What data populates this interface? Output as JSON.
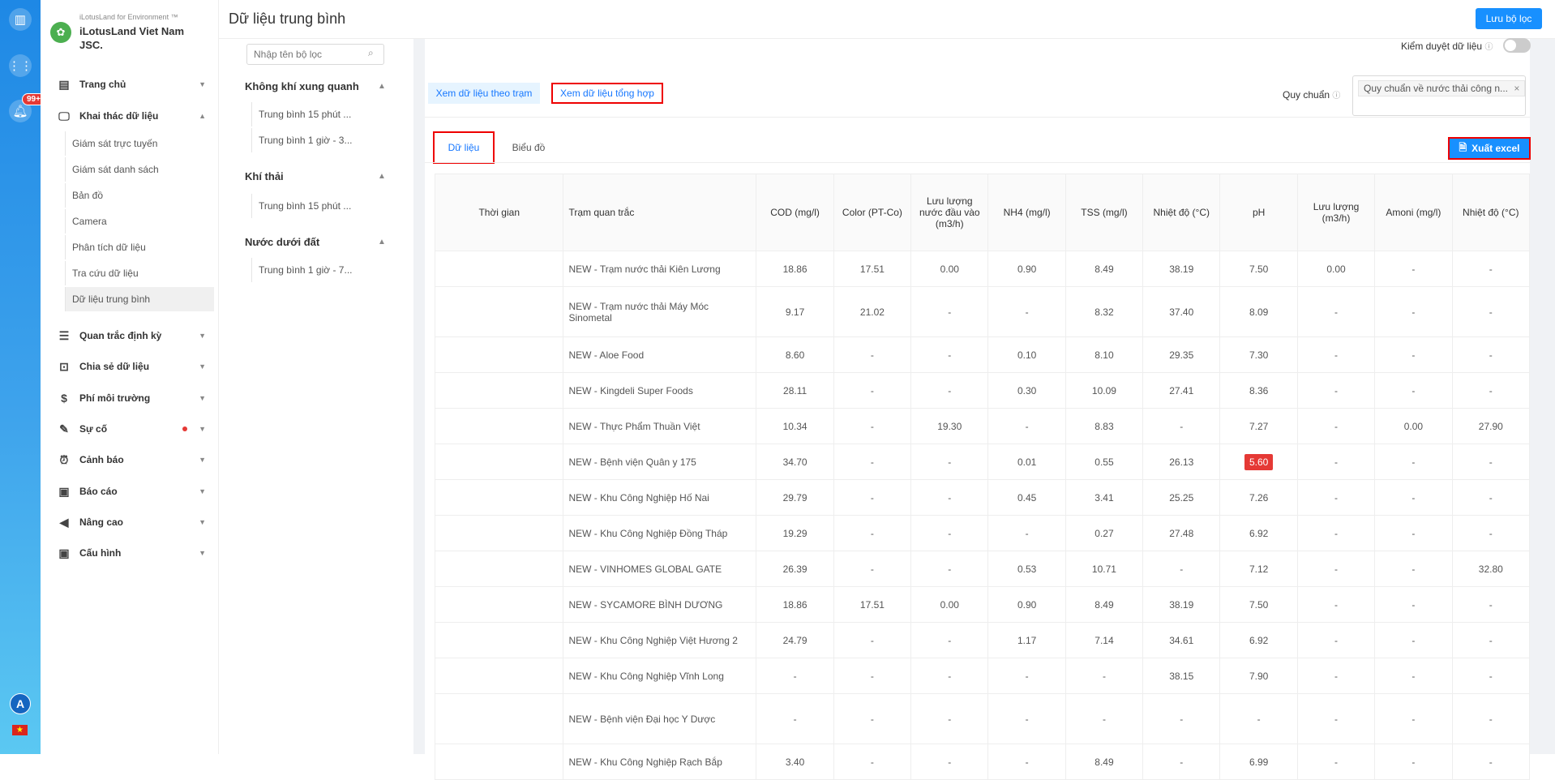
{
  "rail": {
    "badge": "99+",
    "avatar": "A",
    "flag": "★"
  },
  "brand": {
    "sub": "iLotusLand for Environment ™",
    "name": "iLotusLand Viet Nam JSC."
  },
  "nav": {
    "home": "Trang chủ",
    "data_exploit": "Khai thác dữ liệu",
    "sub_items": [
      "Giám sát trực tuyến",
      "Giám sát danh sách",
      "Bản đồ",
      "Camera",
      "Phân tích dữ liệu",
      "Tra cứu dữ liệu",
      "Dữ liệu trung bình"
    ],
    "periodic": "Quan trắc định kỳ",
    "share": "Chia sẻ dữ liệu",
    "fee": "Phí môi trường",
    "incident": "Sự cố",
    "alert": "Cảnh báo",
    "report": "Báo cáo",
    "advanced": "Nâng cao",
    "config": "Cấu hình"
  },
  "header": {
    "title": "Dữ liệu trung bình",
    "save_filter": "Lưu bộ lọc"
  },
  "filters": {
    "search_placeholder": "Nhập tên bộ lọc",
    "groups": [
      {
        "title": "Không khí xung quanh",
        "items": [
          "Trung bình 15 phút ...",
          "Trung bình 1 giờ - 3..."
        ]
      },
      {
        "title": "Khí thải",
        "items": [
          "Trung bình 15 phút ..."
        ]
      },
      {
        "title": "Nước dưới đất",
        "items": [
          "Trung bình 1 giờ - 7..."
        ]
      }
    ]
  },
  "toolbar": {
    "approve_label": "Kiểm duyệt dữ liệu",
    "view_station": "Xem dữ liệu theo trạm",
    "view_aggregate": "Xem dữ liệu tổng hợp",
    "standard_label": "Quy chuẩn",
    "standard_value": "Quy chuẩn về nước thải công n...",
    "tab_data": "Dữ liệu",
    "tab_chart": "Biểu đồ",
    "export": "Xuất excel"
  },
  "table": {
    "headers": [
      "Thời gian",
      "Trạm quan trắc",
      "COD (mg/l)",
      "Color (PT-Co)",
      "Lưu lượng nước đầu vào (m3/h)",
      "NH4 (mg/l)",
      "TSS (mg/l)",
      "Nhiệt độ (°C)",
      "pH",
      "Lưu lượng (m3/h)",
      "Amoni (mg/l)",
      "Nhiệt độ (°C)"
    ],
    "rows": [
      [
        "",
        "NEW - Trạm nước thải Kiên Lương",
        "18.86",
        "17.51",
        "0.00",
        "0.90",
        "8.49",
        "38.19",
        "7.50",
        "0.00",
        "-",
        "-"
      ],
      [
        "",
        "NEW - Trạm nước thải Máy Móc Sinometal",
        "9.17",
        "21.02",
        "-",
        "-",
        "8.32",
        "37.40",
        "8.09",
        "-",
        "-",
        "-"
      ],
      [
        "",
        "NEW - Aloe Food",
        "8.60",
        "-",
        "-",
        "0.10",
        "8.10",
        "29.35",
        "7.30",
        "-",
        "-",
        "-"
      ],
      [
        "",
        "NEW - Kingdeli Super Foods",
        "28.11",
        "-",
        "-",
        "0.30",
        "10.09",
        "27.41",
        "8.36",
        "-",
        "-",
        "-"
      ],
      [
        "",
        "NEW - Thực Phẩm Thuần Việt",
        "10.34",
        "-",
        "19.30",
        "-",
        "8.83",
        "-",
        "7.27",
        "-",
        "0.00",
        "27.90"
      ],
      [
        "",
        "NEW - Bệnh viện Quân y 175",
        "34.70",
        "-",
        "-",
        "0.01",
        "0.55",
        "26.13",
        "5.60",
        "-",
        "-",
        "-"
      ],
      [
        "",
        "NEW -  Khu Công Nghiệp Hố Nai",
        "29.79",
        "-",
        "-",
        "0.45",
        "3.41",
        "25.25",
        "7.26",
        "-",
        "-",
        "-"
      ],
      [
        "",
        "NEW - Khu Công Nghiệp Đồng Tháp",
        "19.29",
        "-",
        "-",
        "-",
        "0.27",
        "27.48",
        "6.92",
        "-",
        "-",
        "-"
      ],
      [
        "",
        "NEW - VINHOMES GLOBAL GATE",
        "26.39",
        "-",
        "-",
        "0.53",
        "10.71",
        "-",
        "7.12",
        "-",
        "-",
        "32.80"
      ],
      [
        "",
        "NEW - SYCAMORE BÌNH DƯƠNG",
        "18.86",
        "17.51",
        "0.00",
        "0.90",
        "8.49",
        "38.19",
        "7.50",
        "-",
        "-",
        "-"
      ],
      [
        "",
        "NEW - Khu Công Nghiệp Việt Hương 2",
        "24.79",
        "-",
        "-",
        "1.17",
        "7.14",
        "34.61",
        "6.92",
        "-",
        "-",
        "-"
      ],
      [
        "",
        "NEW - Khu Công Nghiệp Vĩnh Long",
        "-",
        "-",
        "-",
        "-",
        "-",
        "38.15",
        "7.90",
        "-",
        "-",
        "-"
      ],
      [
        "",
        "NEW - Bệnh viện Đại học Y Dược",
        "-",
        "-",
        "-",
        "-",
        "-",
        "-",
        "-",
        "-",
        "-",
        "-"
      ],
      [
        "",
        "NEW - Khu Công Nghiệp Rạch Bắp",
        "3.40",
        "-",
        "-",
        "-",
        "8.49",
        "-",
        "6.99",
        "-",
        "-",
        "-"
      ]
    ],
    "exceed_color": "#e53935"
  }
}
